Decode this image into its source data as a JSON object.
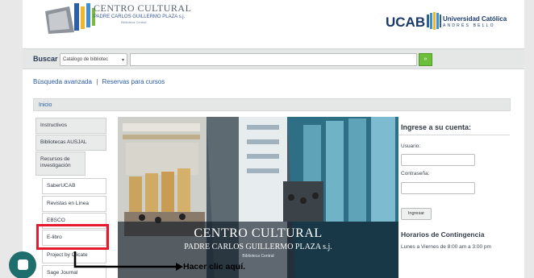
{
  "header": {
    "cc_title": "CENTRO CULTURAL",
    "cc_subtitle": "PADRE CARLOS GUILLERMO PLAZA s.j.",
    "cc_sub2": "Biblioteca Central",
    "ucab_label": "UCAB",
    "uni_name": "Universidad Católica",
    "uni_sub": "ANDRÉS BELLO"
  },
  "search": {
    "label": "Buscar",
    "select_value": "Catálogo de bibliotec",
    "input_value": "",
    "button_icon": "search-arrow-icon"
  },
  "links": {
    "advanced": "Búsqueda avanzada",
    "separator": "|",
    "reserves": "Reservas para cursos"
  },
  "breadcrumb": {
    "home": "Inicio"
  },
  "sidebar": {
    "items": [
      {
        "label": "Instructivos"
      },
      {
        "label": "Bibliotecas AUSJAL"
      },
      {
        "label": "Recursos de investigación"
      },
      {
        "label": "SaberUCAB"
      },
      {
        "label": "Revistas en Línea"
      },
      {
        "label": "EBSCO"
      },
      {
        "label": "E-libro"
      },
      {
        "label": "Project by Clicate"
      },
      {
        "label": "Sage Journal"
      }
    ]
  },
  "hero": {
    "title": "CENTRO CULTURAL",
    "subtitle": "PADRE CARLOS GUILLERMO PLAZA s.j.",
    "sub2": "Biblioteca Central"
  },
  "login": {
    "title": "Ingrese a su cuenta:",
    "user_label": "Usuario:",
    "user_value": "",
    "password_label": "Contraseña:",
    "password_value": "",
    "button": "Ingresar"
  },
  "hours": {
    "title": "Horarios de Contingencia",
    "text": "Lunes a Viernes de 8:00 am a 3:00 pm"
  },
  "annotation": {
    "text": "Hacer clic aquí.",
    "highlight_color": "#e8192c"
  },
  "colors": {
    "accent_green": "#6cbf3c",
    "link_blue": "#2a5aa8",
    "brand_navy": "#1b3a6b",
    "chat_teal": "#1f6e6e"
  },
  "chat": {
    "icon": "chat-bubble-icon"
  }
}
